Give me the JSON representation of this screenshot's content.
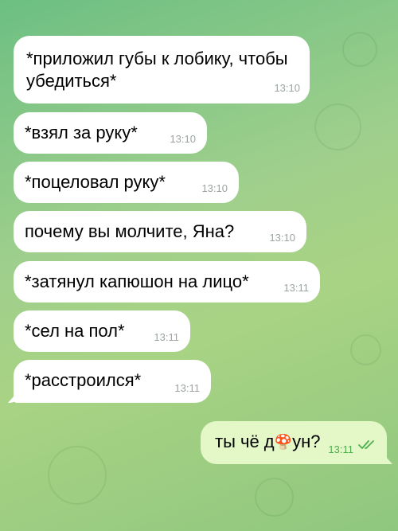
{
  "messages": [
    {
      "text": "*приложил губы к лобику, чтобы убедиться*",
      "time": "13:10"
    },
    {
      "text": "*взял за руку*",
      "time": "13:10"
    },
    {
      "text": "*поцеловал руку*",
      "time": "13:10"
    },
    {
      "text": "почему вы молчите, Яна?",
      "time": "13:10"
    },
    {
      "text": "*затянул капюшон на лицо*",
      "time": "13:11"
    },
    {
      "text": "*сел на пол*",
      "time": "13:11"
    },
    {
      "text": "*расстроился*",
      "time": "13:11"
    }
  ],
  "outgoing": {
    "text_before": "ты чё д",
    "emoji": "🍄",
    "text_after": "ун?",
    "time": "13:11",
    "status_icon": "double-check-icon"
  },
  "colors": {
    "incoming_bubble": "#ffffff",
    "outgoing_bubble": "#e3f7c7",
    "time_incoming": "#9aa3a0",
    "time_outgoing": "#4fae4e"
  }
}
